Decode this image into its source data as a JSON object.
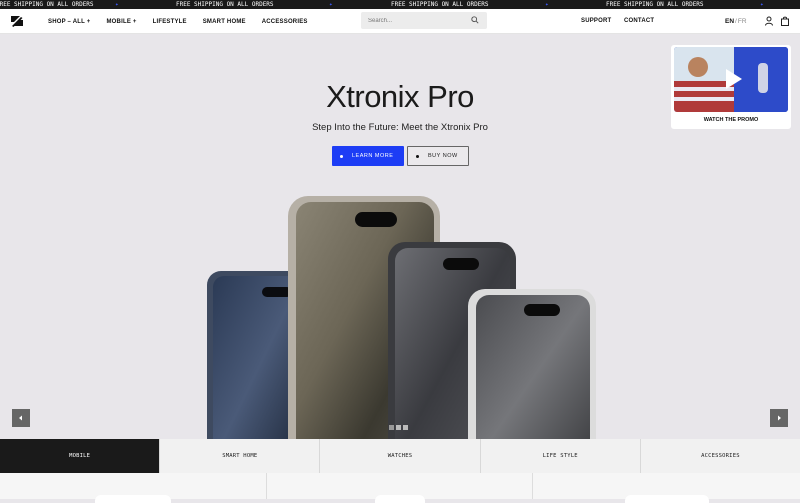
{
  "ticker": {
    "items": [
      "FREE SHIPPING ON ALL ORDERS",
      "FREE SHIPPING ON ALL ORDERS",
      "FREE SHIPPING ON ALL ORDERS",
      "FREE SHIPPING ON ALL ORDERS"
    ],
    "separator": "✦"
  },
  "nav": {
    "links": [
      {
        "label": "SHOP – ALL +"
      },
      {
        "label": "MOBILE +"
      },
      {
        "label": "LIFESTYLE"
      },
      {
        "label": "SMART HOME"
      },
      {
        "label": "ACCESSORIES"
      }
    ],
    "search_placeholder": "Search...",
    "support": "SUPPORT",
    "contact": "CONTACT",
    "lang_active": "EN",
    "lang_sep": "/",
    "lang_other": "FR",
    "icons": [
      "logo-icon",
      "search-icon",
      "account-icon",
      "bag-icon"
    ]
  },
  "hero": {
    "title": "Xtronix Pro",
    "subtitle": "Step Into the Future: Meet the Xtronix Pro",
    "primary_cta": "LEARN MORE",
    "secondary_cta": "BUY NOW",
    "promo_caption": "WATCH THE PROMO",
    "background": "#e8e6ea",
    "accent": "#1d3df5"
  },
  "categories": [
    {
      "label": "MOBILE",
      "active": true
    },
    {
      "label": "SMART HOME",
      "active": false
    },
    {
      "label": "WATCHES",
      "active": false
    },
    {
      "label": "LIFE STYLE",
      "active": false
    },
    {
      "label": "ACCESSORIES",
      "active": false
    }
  ]
}
